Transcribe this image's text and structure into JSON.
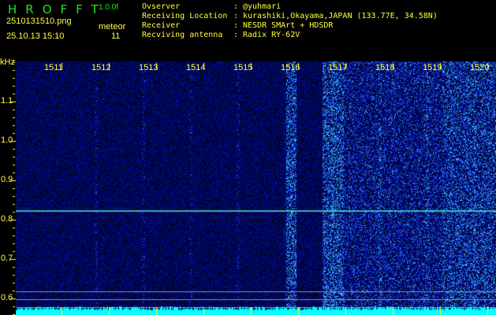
{
  "app": {
    "name": "HROFFT",
    "version": "1.0.0f"
  },
  "file": {
    "name": "2510131510.png",
    "datetime": "25.10.13 15:10"
  },
  "meteor": {
    "label": "meteor",
    "count": "11"
  },
  "info": [
    {
      "label": "Ovserver",
      "value": "@yuhmari"
    },
    {
      "label": "Receiving Location",
      "value": "kurashiki,Okayama,JAPAN (133.77E, 34.58N)"
    },
    {
      "label": "Receiver",
      "value": "NESDR SMArt + HDSDR"
    },
    {
      "label": "Recviving antenna",
      "value": "Radix RY-62V"
    }
  ],
  "axis": {
    "y_unit": "kHz",
    "y_ticks": [
      "1.1",
      "1.0",
      "0.9",
      "0.8",
      "0.7",
      "0.6"
    ],
    "x_ticks": [
      "1511",
      "1512",
      "1513",
      "1514",
      "1515",
      "1516",
      "1517",
      "1518",
      "1519",
      "1520"
    ]
  },
  "colors": {
    "text": "#ffff40",
    "logo": "#20e020",
    "noise": "#00ffff",
    "meteor": "#40ffd0"
  },
  "meteor_trail": {
    "frequency_khz": 0.82
  }
}
